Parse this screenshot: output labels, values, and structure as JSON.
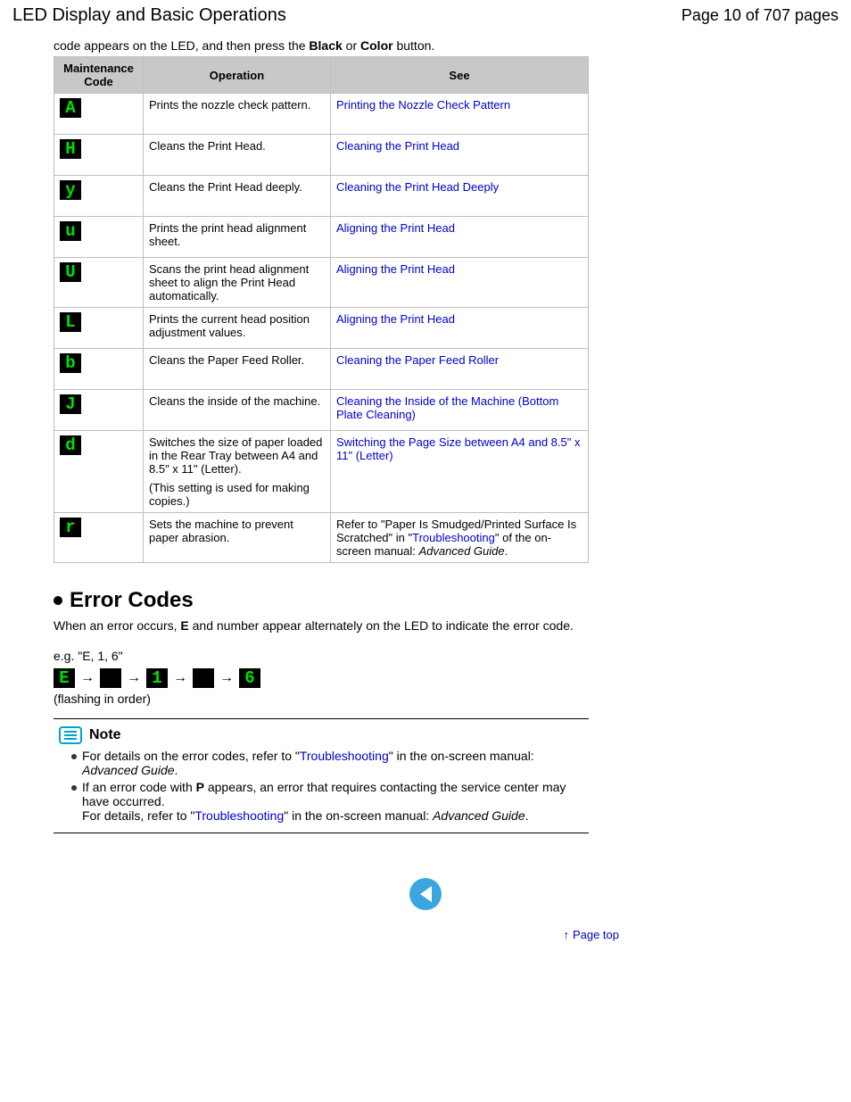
{
  "header": {
    "title": "LED Display and Basic Operations",
    "pager": "Page 10 of 707 pages"
  },
  "intro": {
    "pre": "code appears on the LED, and then press the ",
    "b1": "Black",
    "mid": " or ",
    "b2": "Color",
    "post": " button."
  },
  "table": {
    "h1": "Maintenance Code",
    "h2": "Operation",
    "h3": "See",
    "rows": [
      {
        "code": "A",
        "op": "Prints the nozzle check pattern.",
        "see": "Printing the Nozzle Check Pattern"
      },
      {
        "code": "H",
        "op": "Cleans the Print Head.",
        "see": "Cleaning the Print Head"
      },
      {
        "code": "y",
        "op": "Cleans the Print Head deeply.",
        "see": "Cleaning the Print Head Deeply"
      },
      {
        "code": "u",
        "op": "Prints the print head alignment sheet.",
        "see": "Aligning the Print Head"
      },
      {
        "code": "U",
        "op": "Scans the print head alignment sheet to align the Print Head automatically.",
        "see": "Aligning the Print Head"
      },
      {
        "code": "L",
        "op": "Prints the current head position adjustment values.",
        "see": "Aligning the Print Head"
      },
      {
        "code": "b",
        "op": "Cleans the Paper Feed Roller.",
        "see": "Cleaning the Paper Feed Roller"
      },
      {
        "code": "J",
        "op": "Cleans the inside of the machine.",
        "see": "Cleaning the Inside of the Machine (Bottom Plate Cleaning)"
      },
      {
        "code": "d",
        "op": "Switches the size of paper loaded in the Rear Tray between A4 and 8.5\" x 11\" (Letter).",
        "op2": "(This setting is used for making copies.)",
        "see": "Switching the Page Size between A4 and 8.5\" x 11\" (Letter)"
      },
      {
        "code": "r",
        "op": "Sets the machine to prevent paper abrasion.",
        "see_pre": "Refer to \"Paper Is Smudged/Printed Surface Is Scratched\" in \"",
        "see_link": "Troubleshooting",
        "see_mid": "\" of the on-screen manual: ",
        "see_ital": "Advanced Guide",
        "see_post": "."
      }
    ]
  },
  "error": {
    "heading": "Error Codes",
    "p1_a": "When an error occurs, ",
    "p1_b": "E",
    "p1_c": " and number appear alternately on the LED to indicate the error code.",
    "eg": "e.g. \"E, 1, 6\"",
    "seq": [
      "E",
      "1",
      "6"
    ],
    "flashing": "(flashing in order)"
  },
  "note": {
    "title": "Note",
    "n1_a": "For details on the error codes, refer to \"",
    "n1_link": "Troubleshooting",
    "n1_b": "\" in the on-screen manual: ",
    "n1_ital": "Advanced Guide",
    "n1_c": ".",
    "n2_a": "If an error code with ",
    "n2_b": "P",
    "n2_c": " appears, an error that requires contacting the service center may have occurred.",
    "n2_d": "For details, refer to \"",
    "n2_link": "Troubleshooting",
    "n2_e": "\" in the on-screen manual: ",
    "n2_ital": "Advanced Guide",
    "n2_f": "."
  },
  "pagetop": "Page top"
}
